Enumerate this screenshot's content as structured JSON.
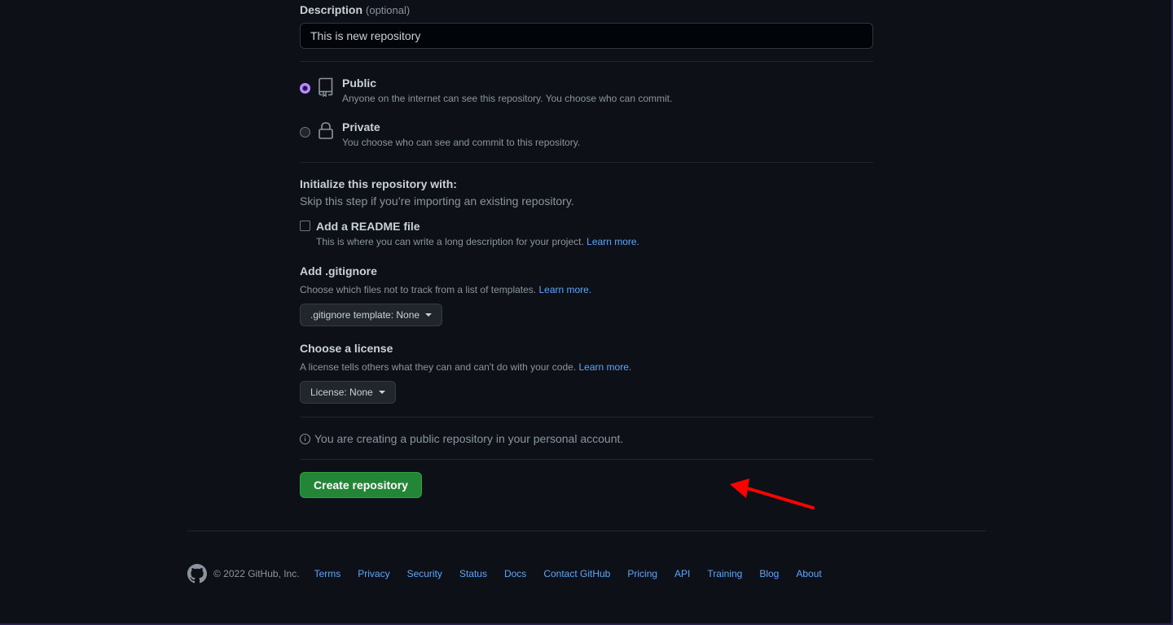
{
  "description": {
    "label": "Description",
    "optional": "(optional)",
    "value": "This is new repository"
  },
  "visibility": {
    "public": {
      "title": "Public",
      "note": "Anyone on the internet can see this repository. You choose who can commit.",
      "selected": true,
      "icon": "repo-icon"
    },
    "private": {
      "title": "Private",
      "note": "You choose who can see and commit to this repository.",
      "selected": false,
      "icon": "lock-icon"
    }
  },
  "initialize": {
    "title": "Initialize this repository with:",
    "subtitle": "Skip this step if you’re importing an existing repository.",
    "readme": {
      "title": "Add a README file",
      "note": "This is where you can write a long description for your project.",
      "link": "Learn more.",
      "checked": false
    }
  },
  "gitignore": {
    "title": "Add .gitignore",
    "note": "Choose which files not to track from a list of templates.",
    "link": "Learn more.",
    "select": ".gitignore template: None"
  },
  "license": {
    "title": "Choose a license",
    "note": "A license tells others what they can and can't do with your code.",
    "link": "Learn more.",
    "select": "License: None"
  },
  "info": {
    "icon": "info-icon",
    "text": "You are creating a public repository in your personal account."
  },
  "create_button": "Create repository",
  "annotation": {
    "type": "arrow",
    "color": "#ff0000",
    "points_to": "create-repository-button"
  },
  "footer": {
    "logo": "github-mark-icon",
    "copyright": "© 2022 GitHub, Inc.",
    "links": [
      "Terms",
      "Privacy",
      "Security",
      "Status",
      "Docs",
      "Contact GitHub",
      "Pricing",
      "API",
      "Training",
      "Blog",
      "About"
    ]
  },
  "colors": {
    "background": "#0d1117",
    "primary_button": "#238636",
    "link": "#58a6ff",
    "radio_selected": "#bf8bff"
  }
}
